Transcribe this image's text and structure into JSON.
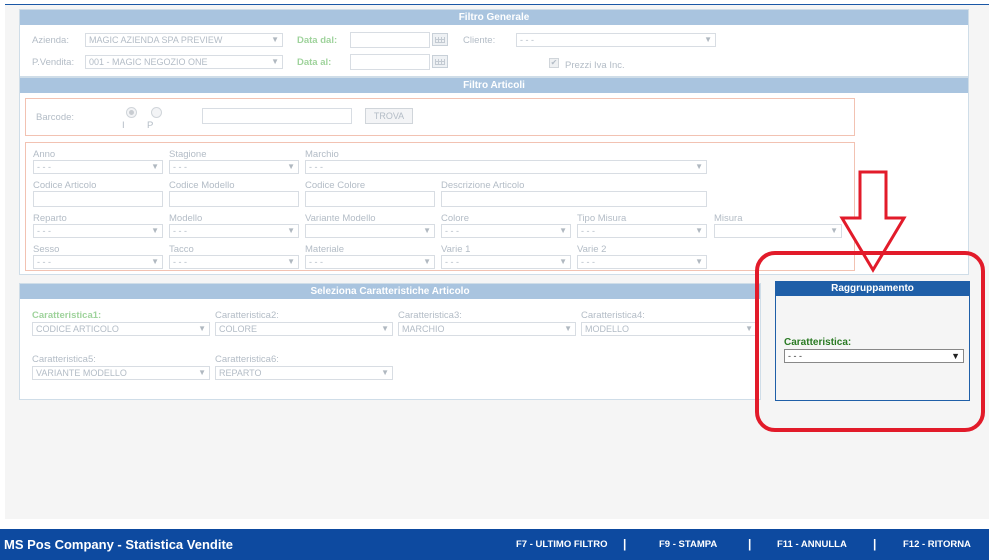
{
  "filtro_generale": {
    "title": "Filtro Generale",
    "azienda_label": "Azienda:",
    "azienda_value": "MAGIC AZIENDA SPA PREVIEW",
    "pvendita_label": "P.Vendita:",
    "pvendita_value": "001 - MAGIC NEGOZIO ONE",
    "data_dal_label": "Data dal:",
    "data_al_label": "Data al:",
    "cliente_label": "Cliente:",
    "cliente_value": "- - -",
    "prezzi_label": "Prezzi Iva Inc."
  },
  "filtro_articoli": {
    "title": "Filtro Articoli",
    "barcode_label": "Barcode:",
    "radio_i": "I",
    "radio_p": "P",
    "trova_label": "TROVA",
    "anno_label": "Anno",
    "stagione_label": "Stagione",
    "marchio_label": "Marchio",
    "codice_articolo_label": "Codice Articolo",
    "codice_modello_label": "Codice Modello",
    "codice_colore_label": "Codice Colore",
    "descrizione_label": "Descrizione Articolo",
    "reparto_label": "Reparto",
    "modello_label": "Modello",
    "variante_label": "Variante Modello",
    "colore_label": "Colore",
    "tipo_misura_label": "Tipo Misura",
    "misura_label": "Misura",
    "sesso_label": "Sesso",
    "tacco_label": "Tacco",
    "materiale_label": "Materiale",
    "varie1_label": "Varie 1",
    "varie2_label": "Varie 2",
    "empty": "- - -"
  },
  "caratteristiche": {
    "title": "Seleziona Caratteristiche Articolo",
    "c1_label": "Caratteristica1:",
    "c1_value": "CODICE ARTICOLO",
    "c2_label": "Caratteristica2:",
    "c2_value": "COLORE",
    "c3_label": "Caratteristica3:",
    "c3_value": "MARCHIO",
    "c4_label": "Caratteristica4:",
    "c4_value": "MODELLO",
    "c5_label": "Caratteristica5:",
    "c5_value": "VARIANTE MODELLO",
    "c6_label": "Caratteristica6:",
    "c6_value": "REPARTO"
  },
  "raggruppamento": {
    "title": "Raggruppamento",
    "label": "Caratteristica:",
    "value": "- - -"
  },
  "footer": {
    "title": "MS Pos Company - Statistica Vendite",
    "f7": "F7 - ULTIMO FILTRO",
    "f9": "F9 - STAMPA",
    "f11": "F11 - ANNULLA",
    "f12": "F12 - RITORNA",
    "sep": "|"
  },
  "colors": {
    "accent": "#1f5fa8",
    "annotation": "#e21b2a",
    "footer": "#0d4aa0"
  }
}
